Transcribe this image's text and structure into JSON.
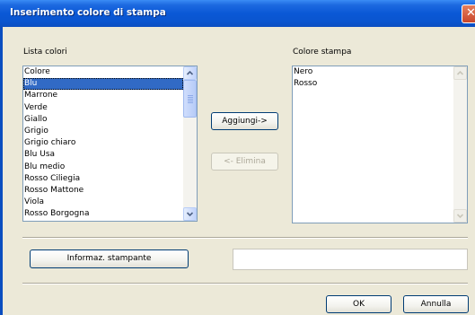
{
  "window": {
    "title": "Inserimento colore di stampa",
    "close_glyph": "✕"
  },
  "left_list": {
    "label": "Lista colori",
    "items": [
      "Colore",
      "Blu",
      "Marrone",
      "Verde",
      "Giallo",
      "Grigio",
      "Grigio chiaro",
      "Blu Usa",
      "Blu medio",
      "Rosso Ciliegia",
      "Rosso Mattone",
      "Viola",
      "Rosso Borgogna"
    ],
    "selected": "Blu"
  },
  "right_list": {
    "label": "Colore stampa",
    "items": [
      "Nero",
      "Rosso"
    ]
  },
  "buttons": {
    "add": "Aggiungi->",
    "remove": "<- Elimina",
    "printer_info": "Informaz. stampante",
    "ok": "OK",
    "cancel": "Annulla"
  },
  "icons": {
    "scroll_up": "▲",
    "scroll_down": "▼"
  },
  "colors": {
    "titlebar": "#0a58d6",
    "selection": "#316ac5",
    "dialog_bg": "#ece9d8"
  }
}
